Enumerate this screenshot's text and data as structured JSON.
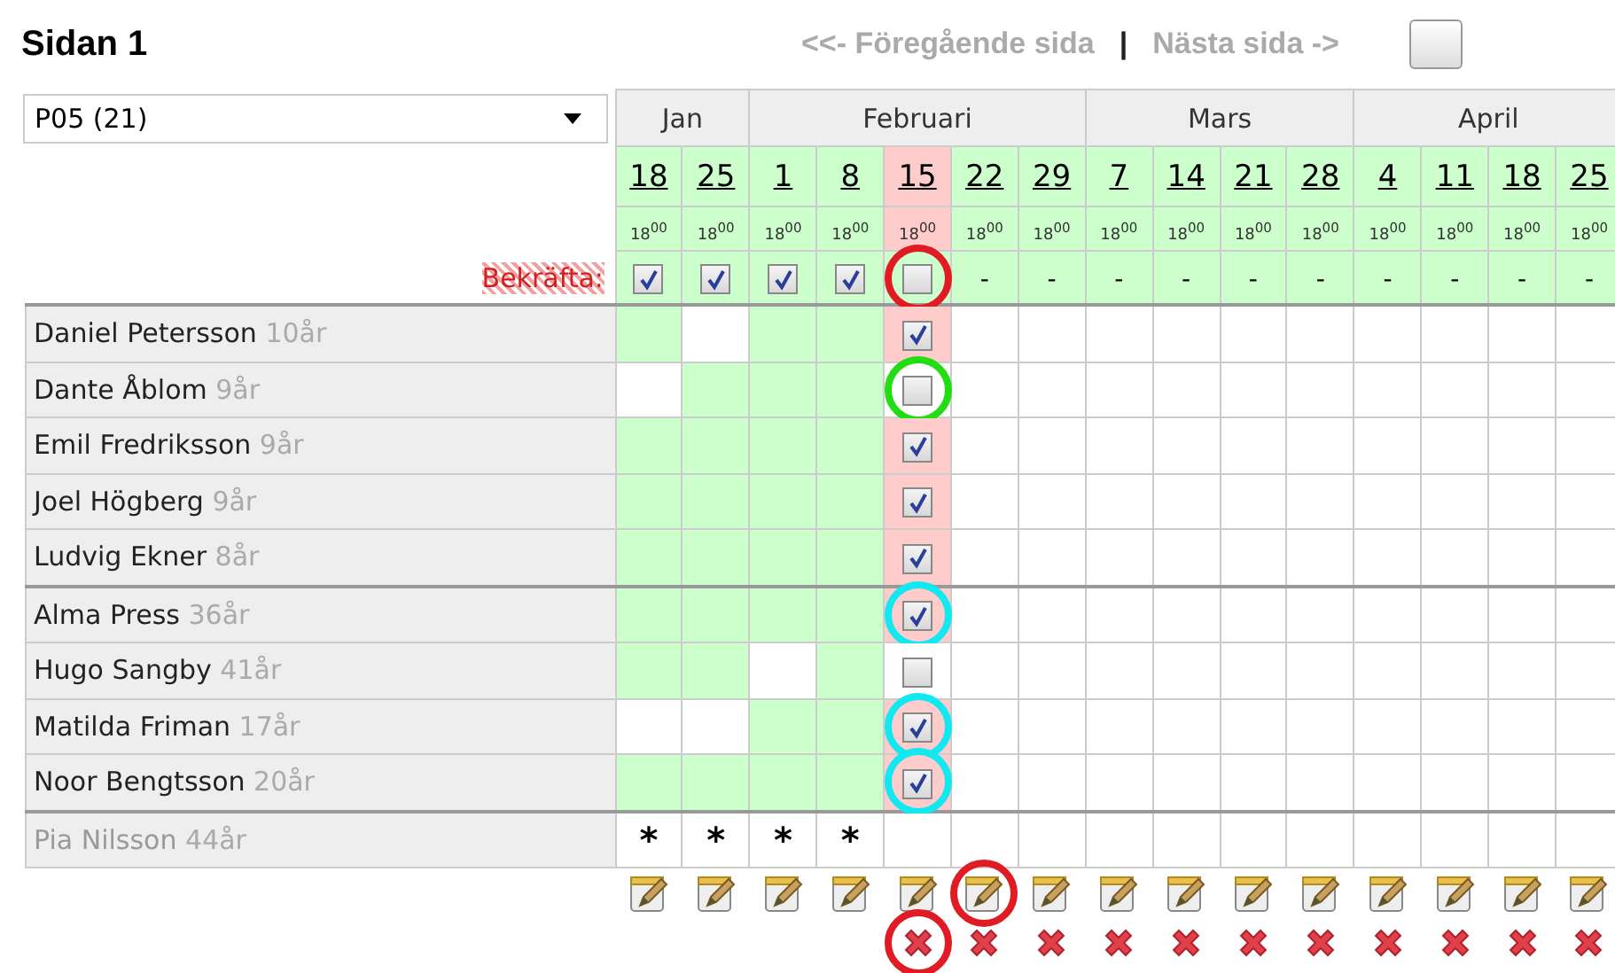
{
  "title": "Sidan 1",
  "nav": {
    "previous": "<<- Föregående sida",
    "separator": "|",
    "next": "Nästa sida ->"
  },
  "selector": {
    "value": "P05 (21)"
  },
  "confirm_label": "Bekräfta:",
  "months": [
    {
      "label": "Jan",
      "dates": [
        {
          "day": "18",
          "time": "18$^{00}$",
          "selected": false,
          "confirm": {
            "kind": "checkbox",
            "checked": true
          },
          "deletable": false
        },
        {
          "day": "25",
          "time": "18$^{00}$",
          "selected": false,
          "confirm": {
            "kind": "checkbox",
            "checked": true
          },
          "deletable": false
        }
      ]
    },
    {
      "label": "Februari",
      "dates": [
        {
          "day": "1",
          "time": "18$^{00}$",
          "selected": false,
          "confirm": {
            "kind": "checkbox",
            "checked": true
          },
          "deletable": false
        },
        {
          "day": "8",
          "time": "18$^{00}$",
          "selected": false,
          "confirm": {
            "kind": "checkbox",
            "checked": true
          },
          "deletable": false
        },
        {
          "day": "15",
          "time": "18$^{00}$",
          "selected": true,
          "confirm": {
            "kind": "checkbox",
            "checked": false,
            "ring": {
              "color": "#e01b24"
            }
          },
          "deletable": true,
          "delete_ring": {
            "color": "#e01b24"
          }
        },
        {
          "day": "22",
          "time": "18$^{00}$",
          "selected": false,
          "confirm": {
            "kind": "dash",
            "text": "-"
          },
          "deletable": true,
          "edit_ring": {
            "color": "#e01b24"
          }
        },
        {
          "day": "29",
          "time": "18$^{00}$",
          "selected": false,
          "confirm": {
            "kind": "dash",
            "text": "-"
          },
          "deletable": true
        }
      ]
    },
    {
      "label": "Mars",
      "dates": [
        {
          "day": "7",
          "time": "18$^{00}$",
          "selected": false,
          "confirm": {
            "kind": "dash",
            "text": "-"
          },
          "deletable": true
        },
        {
          "day": "14",
          "time": "18$^{00}$",
          "selected": false,
          "confirm": {
            "kind": "dash",
            "text": "-"
          },
          "deletable": true
        },
        {
          "day": "21",
          "time": "18$^{00}$",
          "selected": false,
          "confirm": {
            "kind": "dash",
            "text": "-"
          },
          "deletable": true
        },
        {
          "day": "28",
          "time": "18$^{00}$",
          "selected": false,
          "confirm": {
            "kind": "dash",
            "text": "-"
          },
          "deletable": true
        }
      ]
    },
    {
      "label": "April",
      "dates": [
        {
          "day": "4",
          "time": "18$^{00}$",
          "selected": false,
          "confirm": {
            "kind": "dash",
            "text": "-"
          },
          "deletable": true
        },
        {
          "day": "11",
          "time": "18$^{00}$",
          "selected": false,
          "confirm": {
            "kind": "dash",
            "text": "-"
          },
          "deletable": true
        },
        {
          "day": "18",
          "time": "18$^{00}$",
          "selected": false,
          "confirm": {
            "kind": "dash",
            "text": "-"
          },
          "deletable": true
        },
        {
          "day": "25",
          "time": "18$^{00}$",
          "selected": false,
          "confirm": {
            "kind": "dash",
            "text": "-"
          },
          "deletable": true
        }
      ]
    }
  ],
  "groups": [
    {
      "members": [
        {
          "name": "Daniel Petersson",
          "age": "10år",
          "inactive": false,
          "cells": [
            {
              "available": true
            },
            {
              "available": false
            },
            {
              "available": true
            },
            {
              "available": true
            }
          ],
          "confirmed": {
            "checked": true
          }
        },
        {
          "name": "Dante Åblom",
          "age": "9år",
          "inactive": false,
          "cells": [
            {
              "available": false
            },
            {
              "available": true
            },
            {
              "available": true
            },
            {
              "available": true
            }
          ],
          "confirmed": {
            "checked": false,
            "ring": {
              "color": "#22dd11"
            }
          }
        },
        {
          "name": "Emil Fredriksson",
          "age": "9år",
          "inactive": false,
          "cells": [
            {
              "available": true
            },
            {
              "available": true
            },
            {
              "available": true
            },
            {
              "available": true
            }
          ],
          "confirmed": {
            "checked": true
          }
        },
        {
          "name": "Joel Högberg",
          "age": "9år",
          "inactive": false,
          "cells": [
            {
              "available": true
            },
            {
              "available": true
            },
            {
              "available": true
            },
            {
              "available": true
            }
          ],
          "confirmed": {
            "checked": true
          }
        },
        {
          "name": "Ludvig Ekner",
          "age": "8år",
          "inactive": false,
          "cells": [
            {
              "available": true
            },
            {
              "available": true
            },
            {
              "available": true
            },
            {
              "available": true
            }
          ],
          "confirmed": {
            "checked": true
          }
        }
      ]
    },
    {
      "members": [
        {
          "name": "Alma Press",
          "age": "36år",
          "inactive": false,
          "cells": [
            {
              "available": true
            },
            {
              "available": true
            },
            {
              "available": true
            },
            {
              "available": true
            }
          ],
          "confirmed": {
            "checked": true,
            "ring": {
              "color": "#11e8f0"
            }
          }
        },
        {
          "name": "Hugo Sangby",
          "age": "41år",
          "inactive": false,
          "cells": [
            {
              "available": true
            },
            {
              "available": true
            },
            {
              "available": false
            },
            {
              "available": true
            }
          ],
          "confirmed": {
            "checked": false
          }
        },
        {
          "name": "Matilda Friman",
          "age": "17år",
          "inactive": false,
          "cells": [
            {
              "available": false
            },
            {
              "available": false
            },
            {
              "available": true
            },
            {
              "available": true
            }
          ],
          "confirmed": {
            "checked": true,
            "ring": {
              "color": "#11e8f0"
            }
          }
        },
        {
          "name": "Noor Bengtsson",
          "age": "20år",
          "inactive": false,
          "cells": [
            {
              "available": true
            },
            {
              "available": true
            },
            {
              "available": true
            },
            {
              "available": true
            }
          ],
          "confirmed": {
            "checked": true,
            "ring": {
              "color": "#11e8f0"
            }
          }
        }
      ]
    },
    {
      "members": [
        {
          "name": "Pia Nilsson",
          "age": "44år",
          "inactive": true,
          "cells": [
            {
              "text": "*"
            },
            {
              "text": "*"
            },
            {
              "text": "*"
            },
            {
              "text": "*"
            }
          ]
        }
      ]
    }
  ]
}
